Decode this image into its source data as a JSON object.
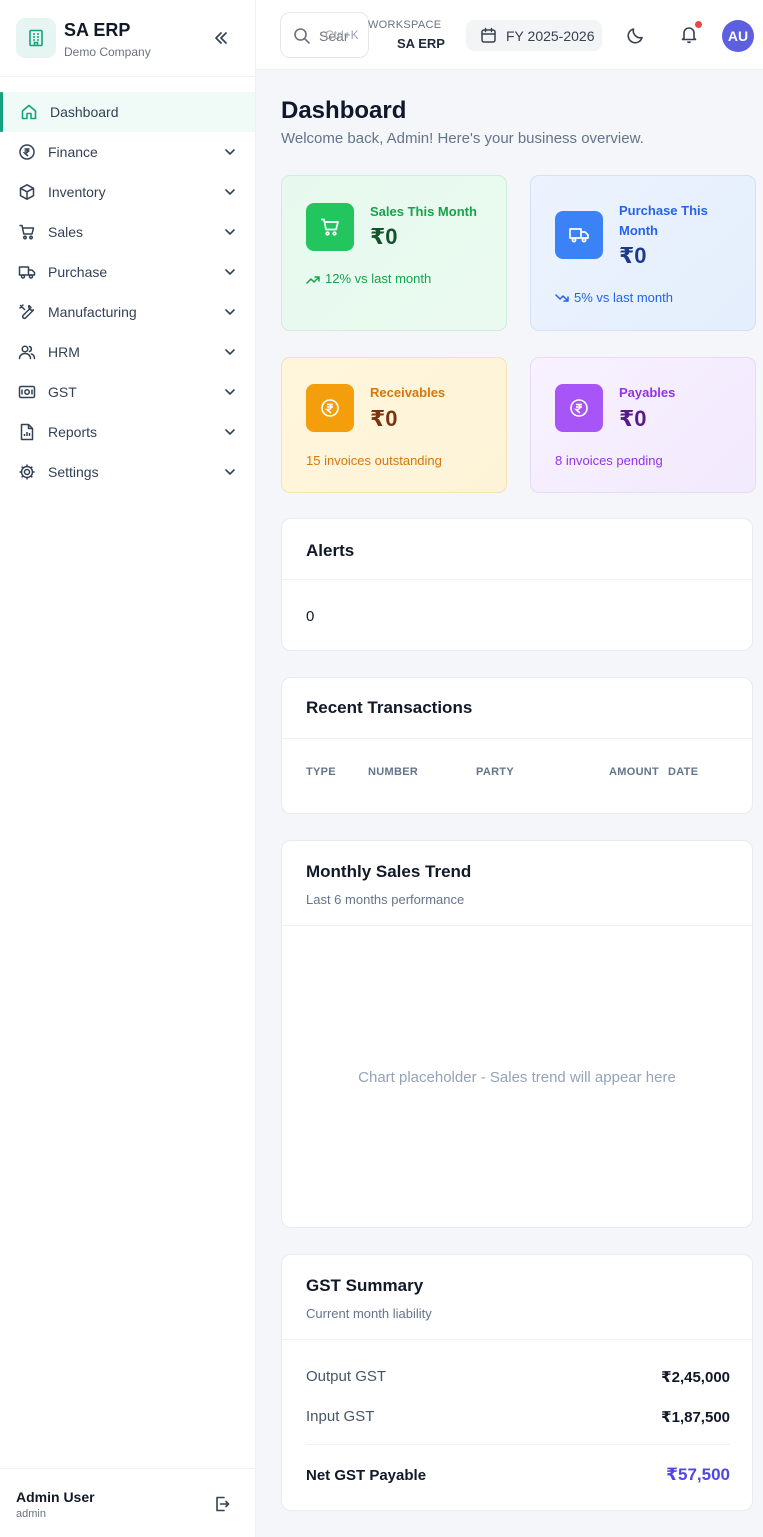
{
  "brand": {
    "title": "SA ERP",
    "subtitle": "Demo Company"
  },
  "nav": {
    "items": [
      {
        "label": "Dashboard",
        "icon": "home-icon"
      },
      {
        "label": "Finance",
        "icon": "rupee-icon"
      },
      {
        "label": "Inventory",
        "icon": "box-icon"
      },
      {
        "label": "Sales",
        "icon": "cart-icon"
      },
      {
        "label": "Purchase",
        "icon": "truck-icon"
      },
      {
        "label": "Manufacturing",
        "icon": "tools-icon"
      },
      {
        "label": "HRM",
        "icon": "users-icon"
      },
      {
        "label": "GST",
        "icon": "receipt-icon"
      },
      {
        "label": "Reports",
        "icon": "report-icon"
      },
      {
        "label": "Settings",
        "icon": "gear-icon"
      }
    ]
  },
  "user": {
    "name": "Admin User",
    "role": "admin",
    "initials": "AU"
  },
  "header": {
    "search_placeholder": "Sear",
    "search_shortcut": "Ctrl+K",
    "workspace_label": "WORKSPACE",
    "workspace_name": "SA ERP",
    "fiscal_year": "FY 2025-2026"
  },
  "page": {
    "title": "Dashboard",
    "subtitle": "Welcome back, Admin! Here's your business overview."
  },
  "stats": {
    "sales": {
      "label": "Sales This Month",
      "value": "₹0",
      "foot": "12% vs last month"
    },
    "purchase": {
      "label": "Purchase This Month",
      "value": "₹0",
      "foot": "5% vs last month"
    },
    "receivables": {
      "label": "Receivables",
      "value": "₹0",
      "foot": "15 invoices outstanding"
    },
    "payables": {
      "label": "Payables",
      "value": "₹0",
      "foot": "8 invoices pending"
    }
  },
  "alerts": {
    "title": "Alerts",
    "count": "0"
  },
  "transactions": {
    "title": "Recent Transactions",
    "columns": [
      "TYPE",
      "NUMBER",
      "PARTY",
      "AMOUNT",
      "DATE"
    ]
  },
  "sales_trend": {
    "title": "Monthly Sales Trend",
    "subtitle": "Last 6 months performance",
    "placeholder": "Chart placeholder - Sales trend will appear here"
  },
  "gst": {
    "title": "GST Summary",
    "subtitle": "Current month liability",
    "output_label": "Output GST",
    "output_value": "₹2,45,000",
    "input_label": "Input GST",
    "input_value": "₹1,87,500",
    "net_label": "Net GST Payable",
    "net_value": "₹57,500"
  },
  "colors": {
    "accent": "#14a37f",
    "sales": "#22c55e",
    "purchase": "#3b82f6",
    "receivables": "#f59e0b",
    "payables": "#a855f7",
    "avatar": "#5b5fe0",
    "net_gst": "#4f46e5"
  }
}
